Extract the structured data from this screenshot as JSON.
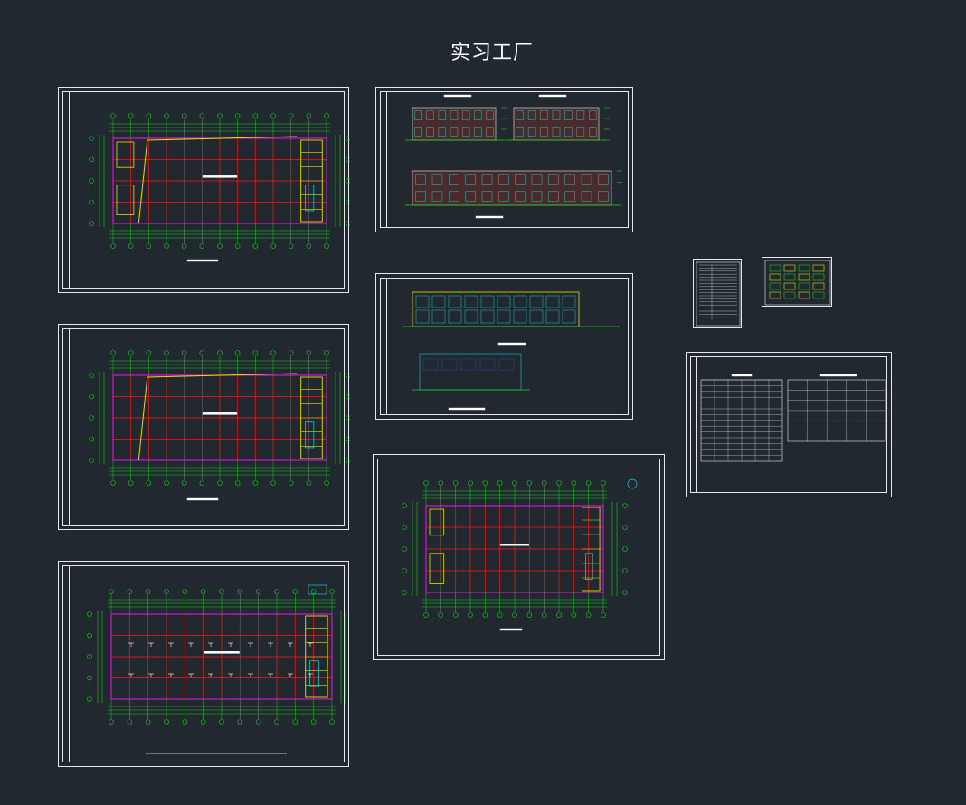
{
  "canvas": {
    "title": "实习工厂",
    "background": "#212830",
    "colors": {
      "frame": "#e8e8e8",
      "grid": "#d01818",
      "wall": "#e8e000",
      "dims": "#18d018",
      "cyan": "#18c8d0",
      "magenta": "#d018d0"
    }
  },
  "sheets": [
    {
      "name": "ground-floor-plan",
      "kind": "plan-large"
    },
    {
      "name": "elevations-a",
      "kind": "elevations"
    },
    {
      "name": "second-floor-plan",
      "kind": "plan-large"
    },
    {
      "name": "elevations-sections",
      "kind": "elevations"
    },
    {
      "name": "roof-plan",
      "kind": "plan-large"
    },
    {
      "name": "floor-plan-variant",
      "kind": "plan-large"
    },
    {
      "name": "index-sheet",
      "kind": "table"
    },
    {
      "name": "detail-sheet",
      "kind": "detail"
    },
    {
      "name": "schedule-sheet",
      "kind": "table"
    }
  ]
}
